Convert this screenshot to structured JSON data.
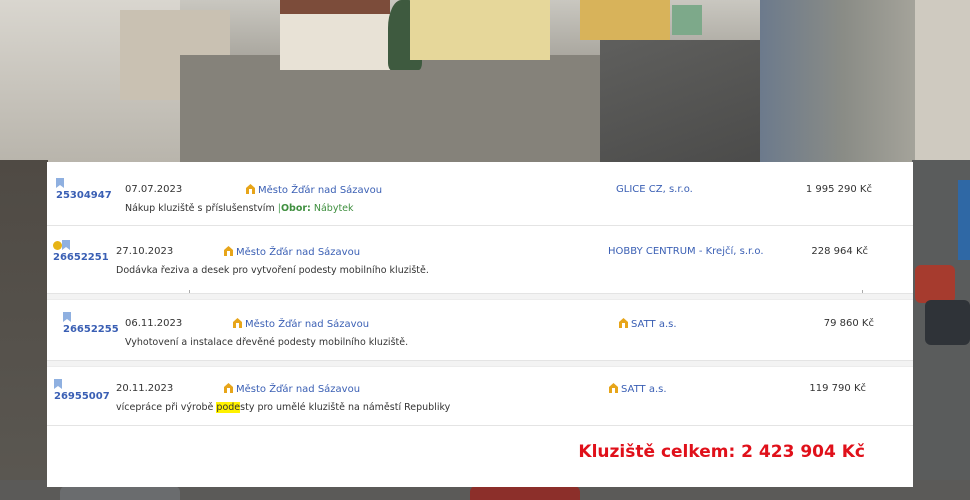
{
  "records": [
    {
      "id": "25304947",
      "date": "07.07.2023",
      "buyer": "Město Žďár nad Sázavou",
      "supplier": "GLICE CZ, s.r.o.",
      "price": "1 995 290 Kč",
      "description": "Nákup kluziště s příslušenstvím",
      "separator": "|",
      "field_label": "Obor:",
      "field_value": "Nábytek"
    },
    {
      "id": "26652251",
      "date": "27.10.2023",
      "buyer": "Město Žďár nad Sázavou",
      "supplier": "HOBBY CENTRUM - Krejčí, s.r.o.",
      "price": "228 964 Kč",
      "description": "Dodávka řeziva a desek pro vytvoření podesty mobilního kluziště."
    },
    {
      "id": "26652255",
      "date": "06.11.2023",
      "buyer": "Město Žďár nad Sázavou",
      "supplier": "SATT a.s.",
      "price": "79 860 Kč",
      "description": "Vyhotovení a instalace dřevěné podesty mobilního kluziště."
    },
    {
      "id": "26955007",
      "date": "20.11.2023",
      "buyer": "Město Žďár nad Sázavou",
      "supplier": "SATT a.s.",
      "price": "119 790 Kč",
      "description_before": "vícepráce při výrobě ",
      "description_highlight": "pode",
      "description_after": "sty pro umělé kluziště na náměstí Republiky"
    }
  ],
  "total": "Kluziště celkem: 2 423 904 Kč",
  "icons": {
    "bookmark": "bookmark-icon",
    "buyer": "house-icon",
    "supplier": "house-icon",
    "notice": "warning-dot-icon"
  },
  "colors": {
    "link": "#3a5fb4",
    "total": "#e0101a",
    "highlight": "#fff200",
    "category": "#3f8f3f",
    "icon_orange": "#e7a51a"
  }
}
